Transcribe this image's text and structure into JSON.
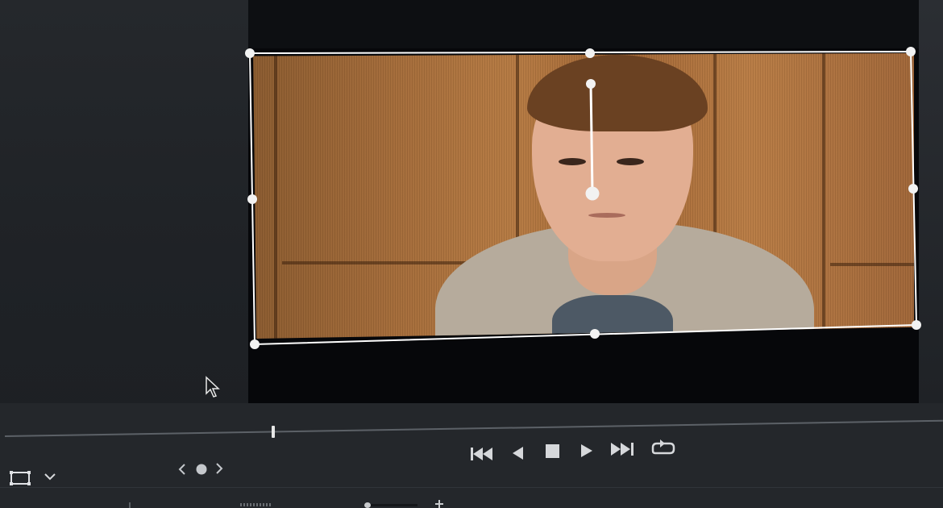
{
  "icons": {
    "transform": "transform-rect-icon",
    "dropdown": "chevron-down-icon",
    "prev_keyframe": "chevron-left-icon",
    "keyframe": "keyframe-dot-icon",
    "next_keyframe": "chevron-right-icon",
    "skip_start": "skip-to-start-icon",
    "step_back": "play-reverse-icon",
    "stop": "stop-icon",
    "play": "play-icon",
    "skip_end": "skip-to-end-icon",
    "loop": "loop-icon",
    "cursor": "mouse-cursor-icon"
  },
  "colors": {
    "viewer_bg": "#06070a",
    "panel_bg": "#24272b",
    "handle": "#ffffff"
  }
}
